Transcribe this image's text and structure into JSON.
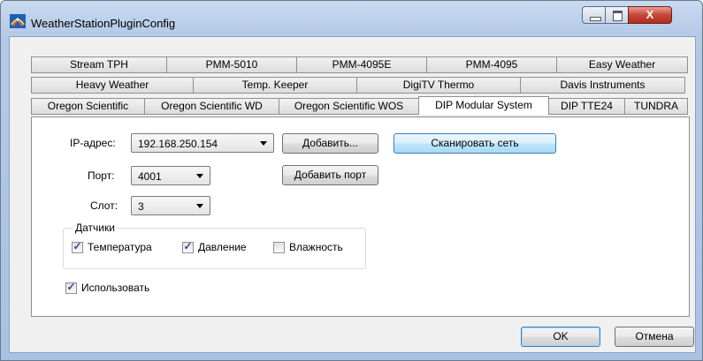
{
  "window": {
    "title": "WeatherStationPluginConfig",
    "close_glyph": "X"
  },
  "tabs": {
    "row1": [
      "Stream TPH",
      "PMM-5010",
      "PMM-4095E",
      "PMM-4095",
      "Easy Weather"
    ],
    "row2": [
      "Heavy Weather",
      "Temp. Keeper",
      "DigiTV Thermo",
      "Davis Instruments"
    ],
    "row3": [
      "Oregon Scientific",
      "Oregon Scientific WD",
      "Oregon Scientific WOS",
      "DIP Modular System",
      "DIP TTE24",
      "TUNDRA"
    ],
    "active": "DIP Modular System"
  },
  "form": {
    "ip_label": "IP-адрес:",
    "ip_value": "192.168.250.154",
    "port_label": "Порт:",
    "port_value": "4001",
    "slot_label": "Слот:",
    "slot_value": "3",
    "add_button": "Добавить...",
    "scan_button": "Сканировать сеть",
    "add_port_button": "Добавить порт",
    "sensors_group": "Датчики",
    "sensors": [
      {
        "label": "Температура",
        "checked": true
      },
      {
        "label": "Давление",
        "checked": true
      },
      {
        "label": "Влажность",
        "checked": false
      }
    ],
    "use_label": "Использовать",
    "use_checked": true,
    "check_mark": "✓"
  },
  "footer": {
    "ok_button": "OK",
    "cancel_button": "Отмена"
  },
  "icons": {
    "app": "satellite-dish-icon",
    "minimize": "minimize-icon",
    "maximize": "maximize-icon",
    "close": "close-icon",
    "dropdown": "chevron-down-icon"
  }
}
